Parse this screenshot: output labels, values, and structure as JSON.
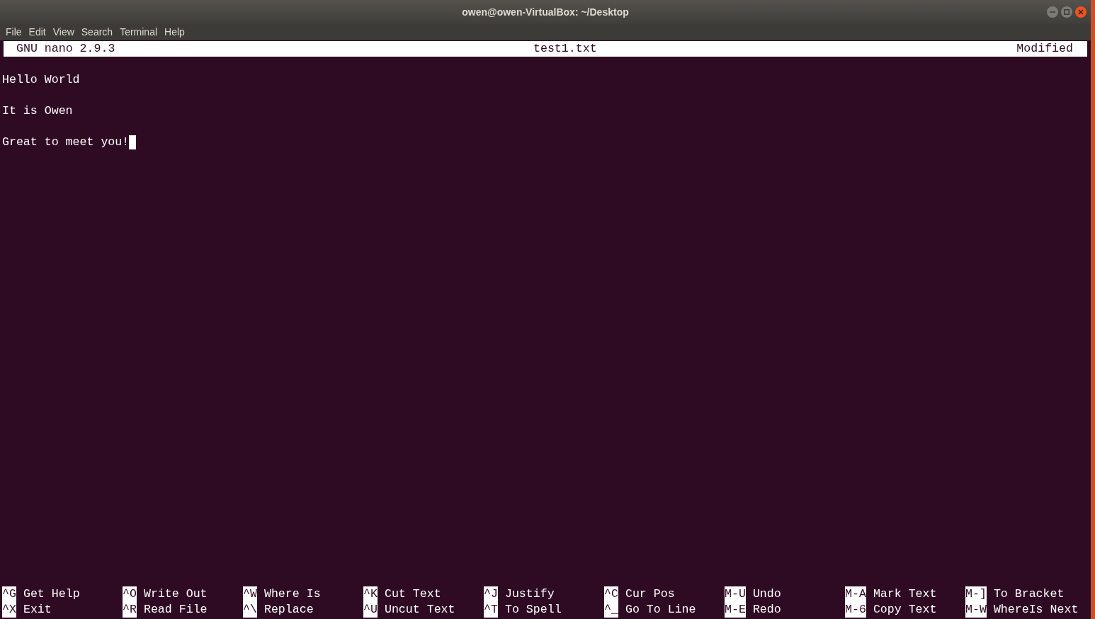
{
  "window": {
    "title": "owen@owen-VirtualBox: ~/Desktop"
  },
  "menu": [
    "File",
    "Edit",
    "View",
    "Search",
    "Terminal",
    "Help"
  ],
  "nano_header": {
    "version": "GNU nano 2.9.3",
    "filename": "test1.txt",
    "status": "Modified"
  },
  "lines": [
    {
      "text": "Hello World"
    },
    {
      "text": "It is Owen"
    },
    {
      "text": "Great to meet you!"
    }
  ],
  "cursor": {
    "visible": true
  },
  "shortcuts": [
    [
      {
        "key": "^G",
        "label": "Get Help"
      },
      {
        "key": "^O",
        "label": "Write Out"
      },
      {
        "key": "^W",
        "label": "Where Is"
      },
      {
        "key": "^K",
        "label": "Cut Text"
      },
      {
        "key": "^J",
        "label": "Justify"
      },
      {
        "key": "^C",
        "label": "Cur Pos"
      },
      {
        "key": "M-U",
        "label": "Undo"
      },
      {
        "key": "M-A",
        "label": "Mark Text"
      },
      {
        "key": "M-]",
        "label": "To Bracket"
      }
    ],
    [
      {
        "key": "^X",
        "label": "Exit"
      },
      {
        "key": "^R",
        "label": "Read File"
      },
      {
        "key": "^\\",
        "label": "Replace"
      },
      {
        "key": "^U",
        "label": "Uncut Text"
      },
      {
        "key": "^T",
        "label": "To Spell"
      },
      {
        "key": "^_",
        "label": "Go To Line"
      },
      {
        "key": "M-E",
        "label": "Redo"
      },
      {
        "key": "M-6",
        "label": "Copy Text"
      },
      {
        "key": "M-W",
        "label": "WhereIs Next"
      }
    ]
  ]
}
